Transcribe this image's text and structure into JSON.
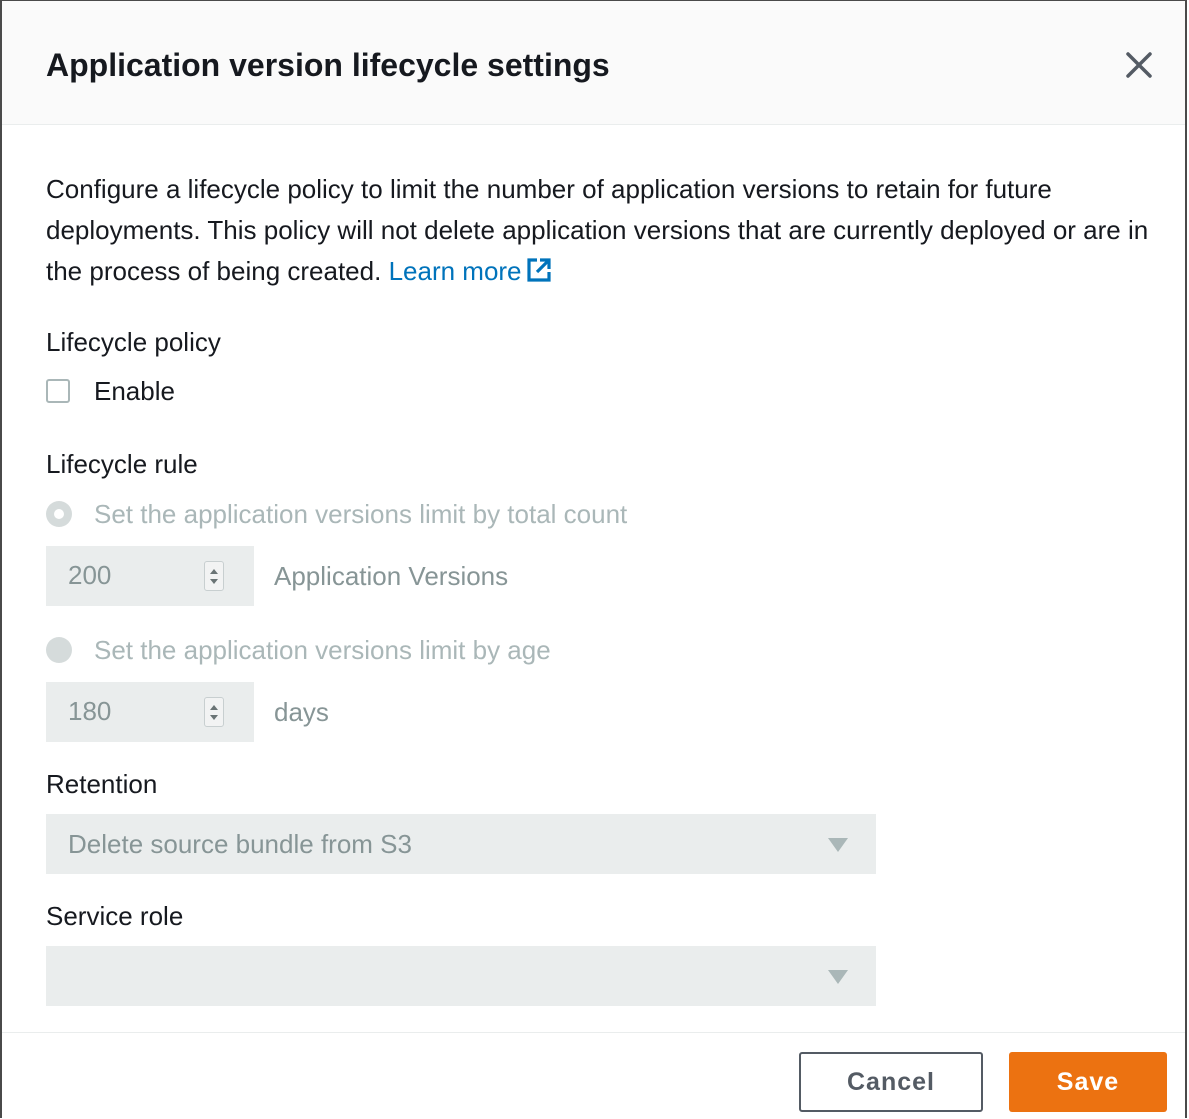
{
  "dialog": {
    "title": "Application version lifecycle settings",
    "close_icon": "close-icon"
  },
  "intro": {
    "text": "Configure a lifecycle policy to limit the number of application versions to retain for future deployments. This policy will not delete application versions that are currently deployed or are in the process of being created.",
    "link_label": "Learn more",
    "link_icon": "external-link-icon"
  },
  "lifecycle_policy": {
    "label": "Lifecycle policy",
    "enable_label": "Enable",
    "enabled": false
  },
  "lifecycle_rule": {
    "label": "Lifecycle rule",
    "by_count": {
      "label": "Set the application versions limit by total count",
      "value": "200",
      "unit": "Application Versions",
      "selected": true
    },
    "by_age": {
      "label": "Set the application versions limit by age",
      "value": "180",
      "unit": "days",
      "selected": false
    }
  },
  "retention": {
    "label": "Retention",
    "value": "Delete source bundle from S3"
  },
  "service_role": {
    "label": "Service role",
    "value": ""
  },
  "footer": {
    "cancel_label": "Cancel",
    "save_label": "Save"
  },
  "colors": {
    "accent": "#ec7211",
    "link": "#0073bb",
    "disabled_text": "#879596",
    "disabled_bg": "#eaeded"
  }
}
